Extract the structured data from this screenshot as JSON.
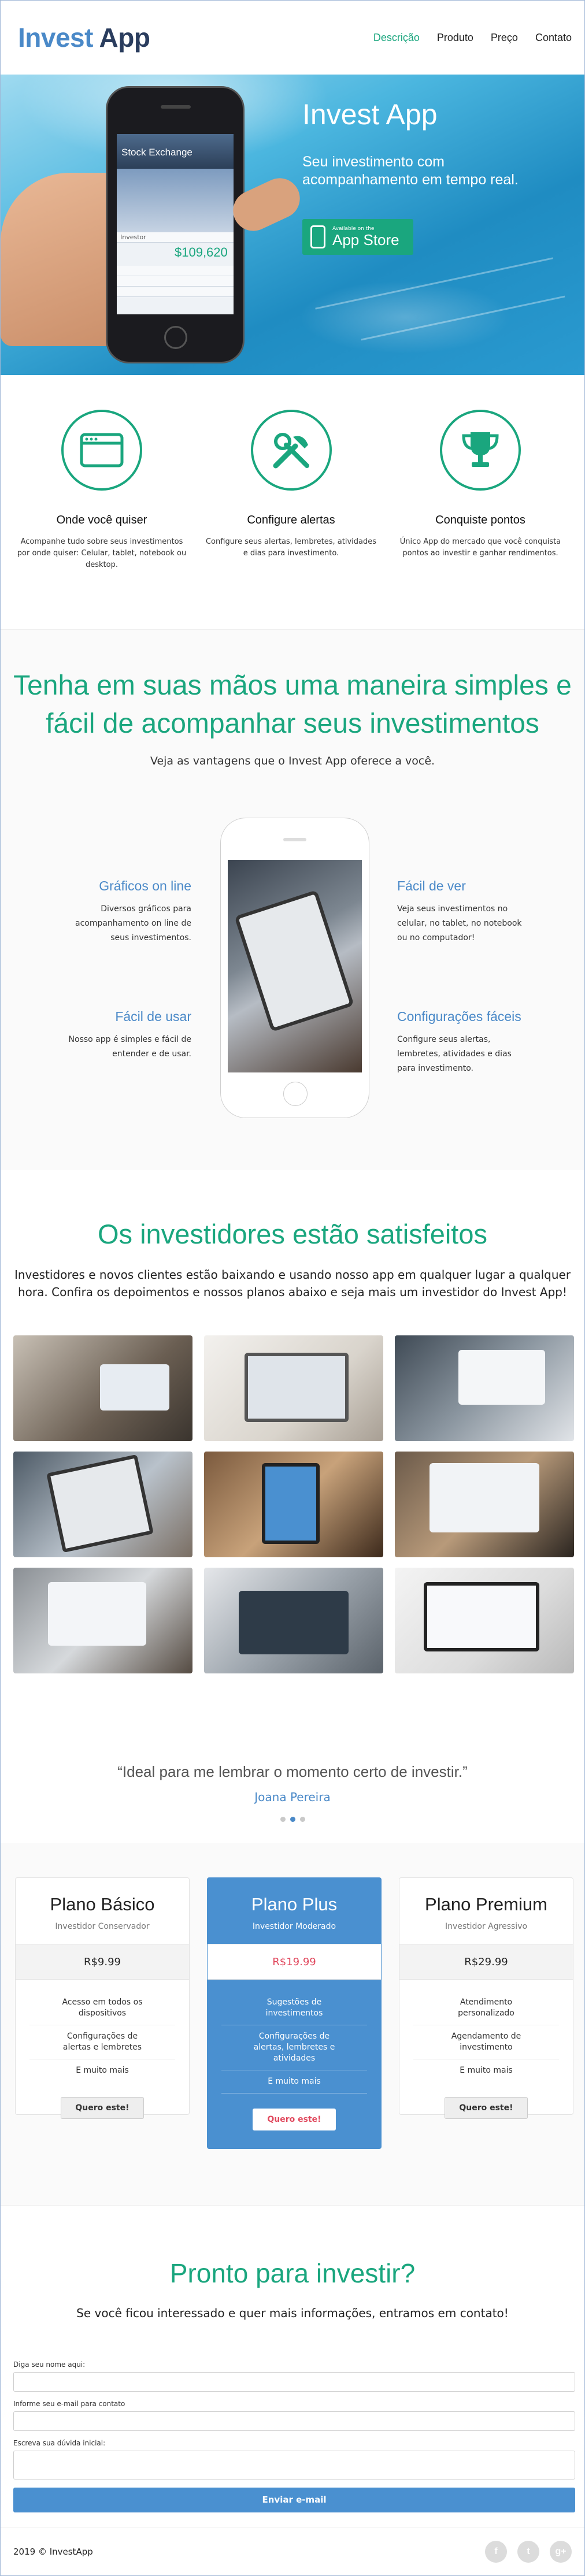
{
  "brand": {
    "part1": "Invest",
    "part2": "App"
  },
  "nav": [
    {
      "label": "Descrição",
      "active": true
    },
    {
      "label": "Produto",
      "active": false
    },
    {
      "label": "Preço",
      "active": false
    },
    {
      "label": "Contato",
      "active": false
    }
  ],
  "hero": {
    "title": "Invest App",
    "subtitle": "Seu investimento com acompanhamento em tempo real.",
    "appstore_small": "Available on the",
    "appstore_big": "App Store",
    "phone_screen": {
      "app_title": "Stock Exchange",
      "label": "Investor",
      "amount": "$109,620"
    }
  },
  "features": [
    {
      "icon": "browser-window-icon",
      "title": "Onde você quiser",
      "text": "Acompanhe tudo sobre seus investimentos por onde quiser: Celular, tablet, notebook ou desktop."
    },
    {
      "icon": "tools-icon",
      "title": "Configure alertas",
      "text": "Configure seus alertas, lembretes, atividades e dias para investimento."
    },
    {
      "icon": "trophy-icon",
      "title": "Conquiste pontos",
      "text": "Único App do mercado que você conquista pontos ao investir e ganhar rendimentos."
    }
  ],
  "simple": {
    "title": "Tenha em suas mãos uma maneira simples e fácil de acompanhar seus investimentos",
    "lead": "Veja as vantagens que o Invest App oferece a você.",
    "items": [
      {
        "title": "Gráficos on line",
        "text": "Diversos gráficos para acompanhamento on line de seus investimentos."
      },
      {
        "title": "Fácil de ver",
        "text": "Veja seus investimentos no celular, no tablet, no notebook ou no computador!"
      },
      {
        "title": "Fácil de usar",
        "text": "Nosso app é simples e fácil de entender e de usar."
      },
      {
        "title": "Configurações fáceis",
        "text": "Configure seus alertas, lembretes, atividades e dias para investimento."
      }
    ]
  },
  "investors": {
    "title": "Os investidores estão satisfeitos",
    "lead": "Investidores e novos clientes estão baixando e usando nosso app em qualquer lugar a qualquer hora. Confira os depoimentos e nossos planos abaixo e seja mais um investidor do Invest App!",
    "photos": [
      "laptop-chart-photo",
      "tablet-chart-photo",
      "laptop-desk-photo",
      "tablet-hands-photo",
      "tablet-coffee-photo",
      "laptop-graph-photo",
      "laptop-dashboard-photo",
      "laptop-analytics-photo",
      "desktop-monitor-photo"
    ]
  },
  "testimonial": {
    "quote": "“Ideal para me lembrar o momento certo de investir.”",
    "author": "Joana Pereira",
    "slides": 3,
    "active": 2
  },
  "plans": [
    {
      "name": "Plano Básico",
      "desc": "Investidor Conservador",
      "price": "R$9.99",
      "features": [
        "Acesso em todos os dispositivos",
        "Configurações de alertas e lembretes",
        "E muito mais"
      ],
      "button": "Quero este!",
      "featured": false
    },
    {
      "name": "Plano Plus",
      "desc": "Investidor Moderado",
      "price": "R$19.99",
      "features": [
        "Sugestões de investimentos",
        "Configurações de alertas, lembretes e atividades",
        "E muito mais"
      ],
      "button": "Quero este!",
      "featured": true
    },
    {
      "name": "Plano Premium",
      "desc": "Investidor Agressivo",
      "price": "R$29.99",
      "features": [
        "Atendimento personalizado",
        "Agendamento de investimento",
        "E muito mais"
      ],
      "button": "Quero este!",
      "featured": false
    }
  ],
  "contact": {
    "title": "Pronto para investir?",
    "lead": "Se você ficou interessado e quer mais informações, entramos em contato!",
    "name_label": "Diga seu nome aqui:",
    "email_label": "Informe seu e-mail para contato",
    "question_label": "Escreva sua dúvida inicial:",
    "submit": "Enviar e-mail"
  },
  "footer": {
    "copyright": "2019 © InvestApp",
    "socials": [
      {
        "icon": "facebook-icon",
        "glyph": "f"
      },
      {
        "icon": "twitter-icon",
        "glyph": "t"
      },
      {
        "icon": "google-plus-icon",
        "glyph": "g+"
      }
    ]
  },
  "colors": {
    "green": "#1aa67e",
    "blue": "#4a89c8",
    "navy": "#2a3d5e",
    "plan_blue": "#4a90d0",
    "price_red": "#e0465b"
  }
}
